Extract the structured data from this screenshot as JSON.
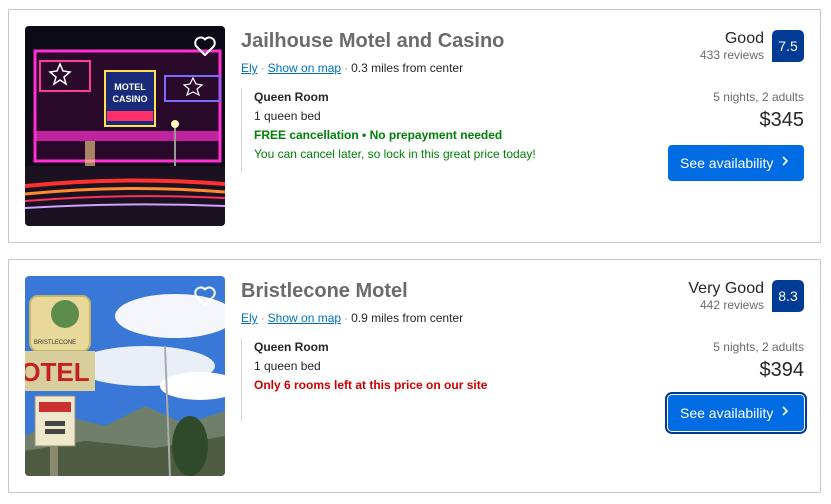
{
  "listings": [
    {
      "title": "Jailhouse Motel and Casino",
      "city": "Ely",
      "map_link": "Show on map",
      "distance": "0.3 miles from center",
      "room": "Queen Room",
      "bed": "1 queen bed",
      "cancellation": "FREE cancellation • No prepayment needed",
      "cancellation_note": "You can cancel later, so lock in this great price today!",
      "score_word": "Good",
      "reviews": "433 reviews",
      "score": "7.5",
      "stay": "5 nights, 2 adults",
      "price": "$345",
      "cta": "See availability"
    },
    {
      "title": "Bristlecone Motel",
      "city": "Ely",
      "map_link": "Show on map",
      "distance": "0.9 miles from center",
      "room": "Queen Room",
      "bed": "1 queen bed",
      "scarcity": "Only 6 rooms left at this price on our site",
      "score_word": "Very Good",
      "reviews": "442 reviews",
      "score": "8.3",
      "stay": "5 nights, 2 adults",
      "price": "$394",
      "cta": "See availability"
    }
  ],
  "icons": {
    "favorite": "heart-outline-icon",
    "chevron": "chevron-right-icon"
  },
  "colors": {
    "brand_blue": "#003b95",
    "button_blue": "#006ce4",
    "link_blue": "#0071c2",
    "green": "#008009",
    "red": "#cc0000"
  }
}
